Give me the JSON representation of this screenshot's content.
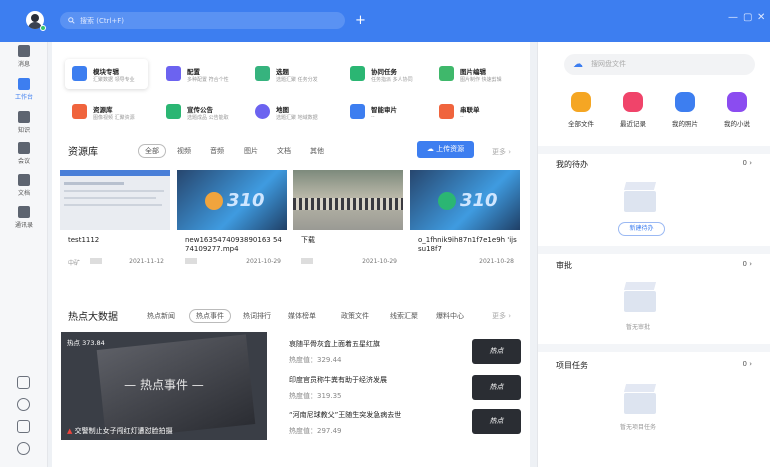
{
  "topbar": {
    "search_placeholder": "搜索 (Ctrl+F)",
    "add_symbol": "+",
    "minimize_symbol": "—",
    "maximize_symbol": "▢",
    "close_symbol": "✕"
  },
  "sidebar": {
    "items": [
      {
        "label": "消息",
        "icon": "message-icon"
      },
      {
        "label": "工作台",
        "icon": "workbench-icon"
      },
      {
        "label": "知识",
        "icon": "knowledge-icon"
      },
      {
        "label": "会议",
        "icon": "meeting-icon"
      },
      {
        "label": "文档",
        "icon": "document-icon"
      },
      {
        "label": "通讯录",
        "icon": "contacts-icon"
      }
    ],
    "active_index": 1
  },
  "apps": [
    {
      "title": "模块专辑",
      "sub": "汇聚数据 领导专业",
      "color": "#3d7ef0"
    },
    {
      "title": "配置",
      "sub": "多种配置 符合个性",
      "color": "#6c63f0"
    },
    {
      "title": "选题",
      "sub": "选题汇聚 任务分发",
      "color": "#36b37e"
    },
    {
      "title": "协同任务",
      "sub": "任务指派 多人协同",
      "color": "#2bb673"
    },
    {
      "title": "图片编辑",
      "sub": "图片制作 快速剪辑",
      "color": "#3fb86b"
    },
    {
      "title": "资源库",
      "sub": "图像视频 汇聚资源",
      "color": "#f0643d"
    },
    {
      "title": "宣传公告",
      "sub": "选题成品 公告能取",
      "color": "#2bb673"
    },
    {
      "title": "地图",
      "sub": "选题汇聚 地域数据",
      "color": "#6c63f0"
    },
    {
      "title": "智能审片",
      "sub": "--",
      "color": "#3d7ef0"
    },
    {
      "title": "串联单",
      "sub": "--",
      "color": "#f0643d"
    }
  ],
  "resources": {
    "title": "资源库",
    "filters": [
      "全部",
      "视频",
      "音频",
      "图片",
      "文档",
      "其他"
    ],
    "active_filter": 0,
    "upload_label": "上传资源",
    "more_label": "更多 ›",
    "items": [
      {
        "name": "test1112",
        "owner": "中矿",
        "date": "2021-11-12"
      },
      {
        "name": "new1635474093890163 5474109277.mp4",
        "owner": "",
        "date": "2021-10-29"
      },
      {
        "name": "下载",
        "owner": "",
        "date": "2021-10-29"
      },
      {
        "name": "o_1fhnik9ih87n1f7e1e9h 'ijssu18f7",
        "owner": "",
        "date": "2021-10-28"
      }
    ]
  },
  "hot": {
    "title": "热点大数据",
    "tabs": [
      "热点新闻",
      "热点事件",
      "热词排行",
      "媒体榜单",
      "政策文件",
      "线索汇聚",
      "爆料中心"
    ],
    "active_tab": 1,
    "more_label": "更多 ›",
    "featured": {
      "heat": "热点 373.84",
      "banner": "— 热点事件 —",
      "caption": "交警制止女子闯红灯遭怼脸拍摄"
    },
    "news": [
      {
        "title": "哀随平骨灰盒上面着五星红旗",
        "value": "热度值：329.44",
        "thumb": "热点"
      },
      {
        "title": "印度官员称牛粪有助于经济发展",
        "value": "热度值：319.35",
        "thumb": "热点"
      },
      {
        "title": "“河南尼球教父”王随生突发急病去世",
        "value": "热度值：297.49",
        "thumb": "热点"
      }
    ]
  },
  "right": {
    "search_placeholder": "搜网盘文件",
    "quick": [
      {
        "label": "全部文件",
        "color": "#f5a623",
        "icon": "folder-icon"
      },
      {
        "label": "最近记录",
        "color": "#f0446a",
        "icon": "clock-icon"
      },
      {
        "label": "我的照片",
        "color": "#3d7ef0",
        "icon": "photo-icon"
      },
      {
        "label": "我的小说",
        "color": "#8b4cf0",
        "icon": "book-icon"
      }
    ],
    "sections": [
      {
        "title": "我的待办",
        "count": "0 ›",
        "empty": "",
        "action": "新建待办"
      },
      {
        "title": "审批",
        "count": "0 ›",
        "empty": "暂无审批",
        "action": ""
      },
      {
        "title": "项目任务",
        "count": "0 ›",
        "empty": "暂无项目任务",
        "action": ""
      }
    ]
  }
}
